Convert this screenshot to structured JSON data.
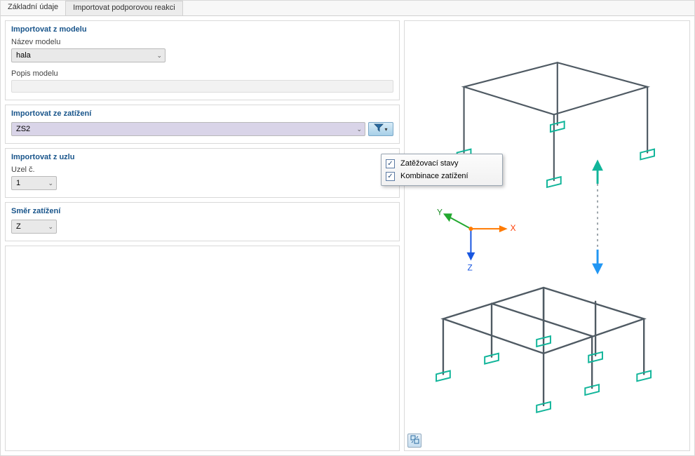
{
  "tabs": {
    "t0": "Základní údaje",
    "t1": "Importovat podporovou reakci"
  },
  "groups": {
    "model": {
      "title": "Importovat z modelu",
      "name_label": "Název modelu",
      "name_value": "hala",
      "desc_label": "Popis modelu",
      "desc_value": ""
    },
    "load": {
      "title": "Importovat ze zatížení",
      "value": "ZS2"
    },
    "node": {
      "title": "Importovat z uzlu",
      "label": "Uzel č.",
      "value": "1"
    },
    "dir": {
      "title": "Směr zatížení",
      "value": "Z"
    }
  },
  "popup": {
    "opt0": "Zatěžovací stavy",
    "opt1": "Kombinace zatížení"
  },
  "axes": {
    "x": "X",
    "y": "Y",
    "z": "Z"
  },
  "glyphs": {
    "check": "✓",
    "chevron": "⌄",
    "tri": "▾"
  }
}
